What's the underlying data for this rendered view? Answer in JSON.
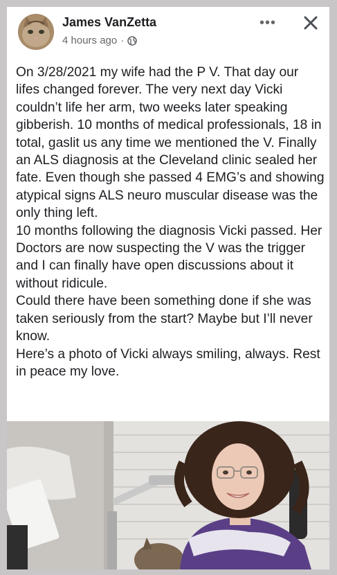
{
  "post": {
    "author": "James VanZetta",
    "time": "4 hours ago",
    "separator": "·",
    "more_label": "•••",
    "paragraphs": [
      "On 3/28/2021 my wife had the P V. That day our lifes changed forever. The very next day Vicki couldn’t life her arm, two weeks later speaking gibberish. 10 months of medical professionals, 18 in total, gaslit us any time we mentioned the V. Finally an ALS diagnosis at the Cleveland clinic sealed her fate. Even though she passed 4 EMG’s and showing atypical signs ALS neuro muscular disease was the only thing left.",
      "10 months following the diagnosis Vicki passed. Her Doctors are now suspecting the V was the trigger and I can finally have open discussions about it without ridicule.",
      "Could there have been something done if she was taken seriously from the start? Maybe but I’ll never know.",
      "Here’s a photo of Vicki always smiling, always. Rest in peace my love."
    ]
  },
  "icons": {
    "avatar": "cat-avatar",
    "privacy": "globe-icon",
    "more": "more-horizontal-icon",
    "close": "close-icon"
  },
  "colors": {
    "background": "#c9c6c8",
    "card": "#ffffff",
    "text": "#1c1e21",
    "secondary_text": "#65676b",
    "sweater": "#5a3f86"
  }
}
